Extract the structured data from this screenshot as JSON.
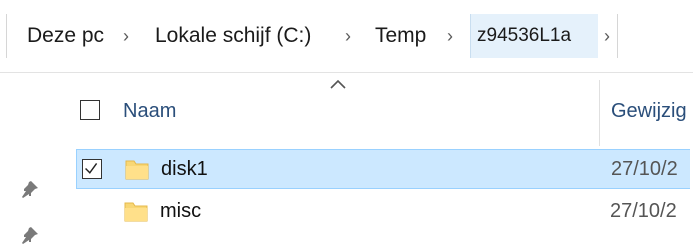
{
  "breadcrumb": {
    "items": [
      "Deze pc",
      "Lokale schijf (C:)",
      "Temp",
      "z94536L1a"
    ],
    "separator": "›"
  },
  "columns": {
    "name": "Naam",
    "modified": "Gewijzig"
  },
  "rows": [
    {
      "name": "disk1",
      "modified": "27/10/2",
      "selected": true,
      "checked": true,
      "icon": "folder-icon"
    },
    {
      "name": "misc",
      "modified": "27/10/2",
      "selected": false,
      "checked": false,
      "icon": "folder-icon"
    }
  ],
  "colors": {
    "selection_bg": "#cce8ff",
    "selection_border": "#99d1ff",
    "folder_yellow": "#f8d775",
    "header_text": "#2a4e7a"
  }
}
